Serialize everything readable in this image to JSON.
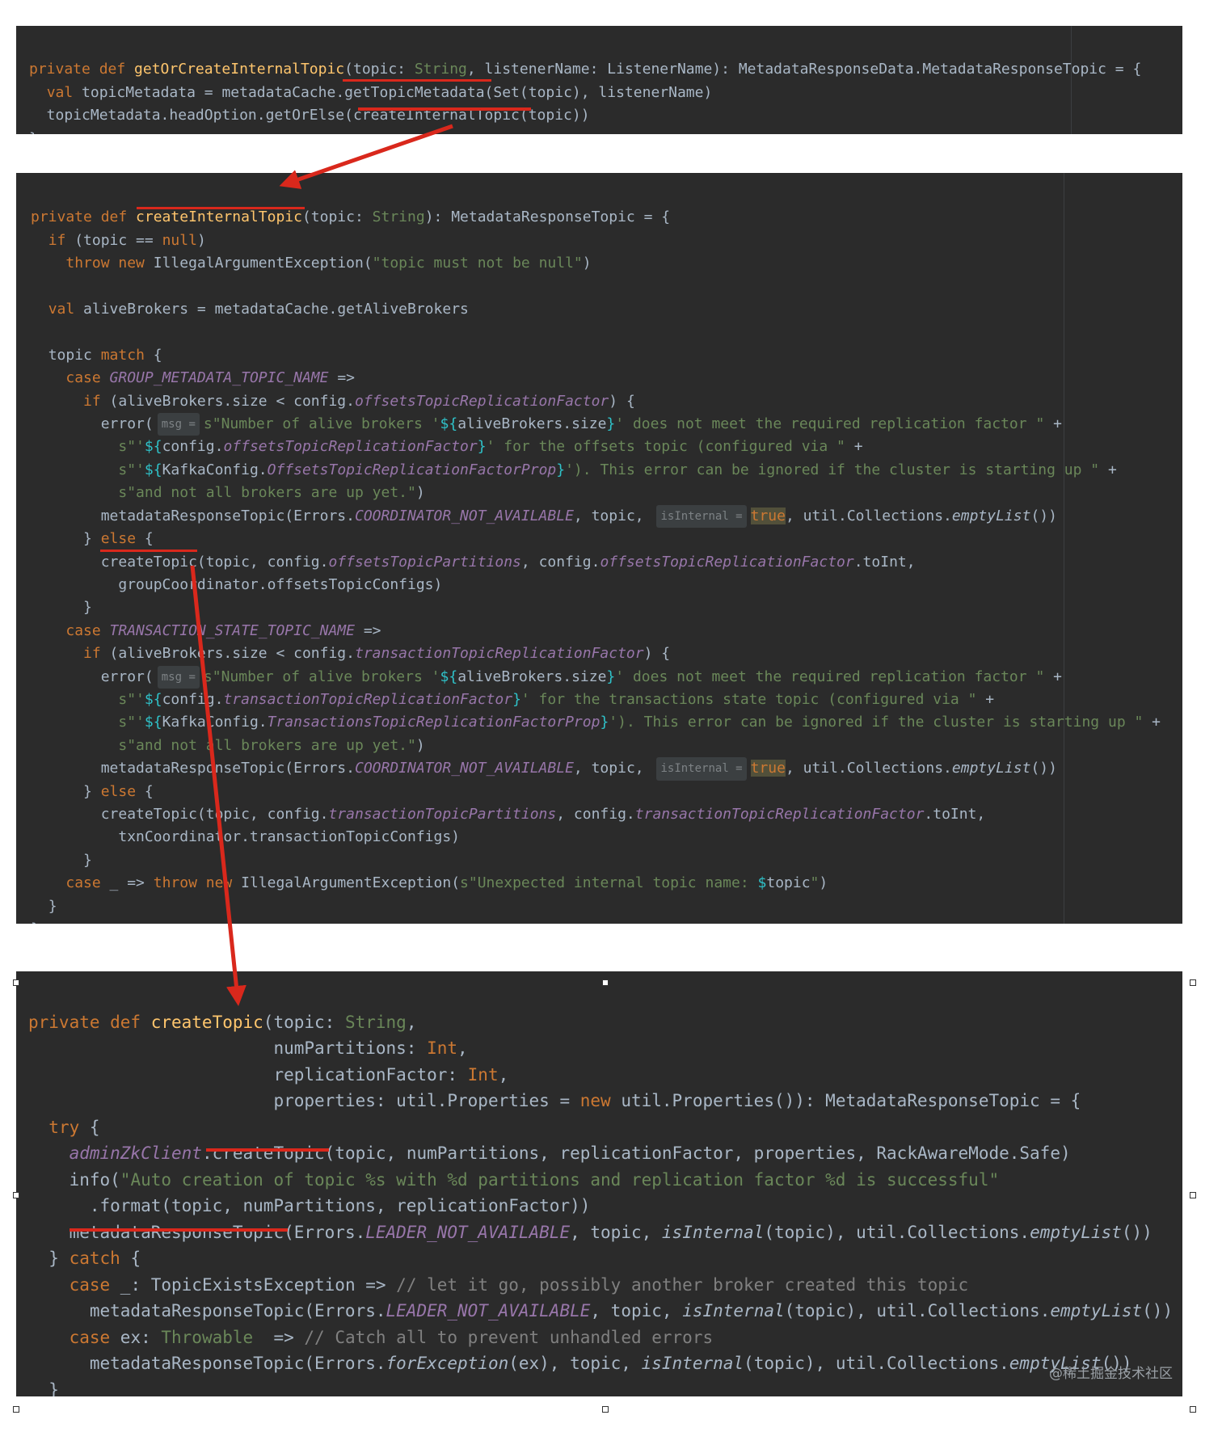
{
  "panel1": {
    "lines": [
      {
        "a": "private def ",
        "b": "getOrCreateInternalTopic",
        "c": "(topic: ",
        "d": "String",
        ",e": "",
        "f": ", listenerName: ListenerName): MetadataResponseData.MetadataResponseTopic = {"
      },
      {
        "a": "val ",
        "b": "topicMetadata = metadataCache.getTopicMetadata(Set(topic), listenerName)"
      },
      {
        "a": "topicMetadata.headOption.getOrElse(createInternalTopic(topic))"
      },
      {
        "a": "}"
      }
    ]
  },
  "panel2": {
    "header": {
      "kw": "private def ",
      "fn": "createInternalTopic",
      "rest1": "(topic: ",
      "type": "String",
      "rest2": "): MetadataResponseTopic = {"
    },
    "if_null": {
      "kw": "if ",
      "rest1": "(topic == ",
      "null": "null",
      "rest2": ")"
    },
    "throw_null": {
      "kw": "throw new ",
      "rest1": "IllegalArgumentException(",
      "str": "\"topic must not be null\"",
      "rest2": ")"
    },
    "alive": {
      "kw": "val ",
      "rest": "aliveBrokers = metadataCache.getAliveBrokers"
    },
    "match": {
      "rest": "topic ",
      "kw": "match ",
      "brace": "{"
    },
    "case1": {
      "kw": "case ",
      "const": "GROUP_METADATA_TOPIC_NAME",
      "arrow": " =>"
    },
    "if1": {
      "kw": "if ",
      "rest1": "(aliveBrokers.size < config.",
      "field": "offsetsTopicReplicationFactor",
      "rest2": ") {"
    },
    "err1a": {
      "rest1": "error(",
      "hint": "msg =",
      "str1": "s\"Number of alive brokers '",
      "dl": "${",
      "rest2": "aliveBrokers.size",
      "dr": "}",
      "str2": "' does not meet the required replication factor \"",
      "plus": " +"
    },
    "err1b": {
      "str1": "s\"'",
      "dl": "${",
      "rest1": "config.",
      "field": "offsetsTopicReplicationFactor",
      "dr": "}",
      "str2": "' for the offsets topic (configured via \"",
      "plus": " +"
    },
    "err1c": {
      "str1": "s\"'",
      "dl": "${",
      "rest1": "KafkaConfig.",
      "field": "OffsetsTopicReplicationFactorProp",
      "dr": "}",
      "str2": "'). This error can be ignored if the cluster is starting up \"",
      "plus": " +"
    },
    "err1d": {
      "str": "s\"and not all brokers are up yet.\"",
      "rest": ")"
    },
    "mrt1": {
      "rest1": "metadataResponseTopic(Errors.",
      "const": "COORDINATOR_NOT_AVAILABLE",
      "rest2": ", topic, ",
      "hint": "isInternal =",
      "val": "true",
      "rest3": ", util.Collections.",
      "fn": "emptyList",
      "rest4": "())"
    },
    "else1": {
      "b1": "} ",
      "kw": "else ",
      "b2": "{"
    },
    "ct1": {
      "rest1": "createTopic(topic, config.",
      "f1": "offsetsTopicPartitions",
      "rest2": ", config.",
      "f2": "offsetsTopicReplicationFactor",
      "rest3": ".toInt,"
    },
    "ct1b": {
      "rest": "groupCoordinator.offsetsTopicConfigs)"
    },
    "close1": {
      "rest": "}"
    },
    "case2": {
      "kw": "case ",
      "const": "TRANSACTION_STATE_TOPIC_NAME",
      "arrow": " =>"
    },
    "if2": {
      "kw": "if ",
      "rest1": "(aliveBrokers.size < config.",
      "field": "transactionTopicReplicationFactor",
      "rest2": ") {"
    },
    "err2a": {
      "rest1": "error(",
      "hint": "msg =",
      "str1": "s\"Number of alive brokers '",
      "dl": "${",
      "rest2": "aliveBrokers.size",
      "dr": "}",
      "str2": "' does not meet the required replication factor \"",
      "plus": " +"
    },
    "err2b": {
      "str1": "s\"'",
      "dl": "${",
      "rest1": "config.",
      "field": "transactionTopicReplicationFactor",
      "dr": "}",
      "str2": "' for the transactions state topic (configured via \"",
      "plus": " +"
    },
    "err2c": {
      "str1": "s\"'",
      "dl": "${",
      "rest1": "KafkaConfig.",
      "field": "TransactionsTopicReplicationFactorProp",
      "dr": "}",
      "str2": "'). This error can be ignored if the cluster is starting up \"",
      "plus": " +"
    },
    "err2d": {
      "str": "s\"and not all brokers are up yet.\"",
      "rest": ")"
    },
    "mrt2": {
      "rest1": "metadataResponseTopic(Errors.",
      "const": "COORDINATOR_NOT_AVAILABLE",
      "rest2": ", topic, ",
      "hint": "isInternal =",
      "val": "true",
      "rest3": ", util.Collections.",
      "fn": "emptyList",
      "rest4": "())"
    },
    "else2": {
      "b1": "} ",
      "kw": "else ",
      "b2": "{"
    },
    "ct2": {
      "rest1": "createTopic(topic, config.",
      "f1": "transactionTopicPartitions",
      "rest2": ", config.",
      "f2": "transactionTopicReplicationFactor",
      "rest3": ".toInt,"
    },
    "ct2b": {
      "rest": "txnCoordinator.transactionTopicConfigs)"
    },
    "close2": {
      "rest": "}"
    },
    "case3": {
      "kw1": "case ",
      "rest1": "_ => ",
      "kw2": "throw new ",
      "rest2": "IllegalArgumentException(",
      "str1": "s\"Unexpected internal topic name: ",
      "dl": "$",
      "rest3": "topic",
      "str2": "\"",
      "rest4": ")"
    },
    "close3": {
      "rest": "}"
    },
    "close4": {
      "rest": "}"
    }
  },
  "panel3": {
    "h1": {
      "kw": "private def ",
      "fn": "createTopic",
      "rest1": "(topic: ",
      "type": "String",
      "rest2": ","
    },
    "h2": {
      "rest1": "numPartitions: ",
      "type": "Int",
      "rest2": ","
    },
    "h3": {
      "rest1": "replicationFactor: ",
      "type": "Int",
      "rest2": ","
    },
    "h4": {
      "rest1": "properties: util.Properties = ",
      "kw": "new ",
      "rest2": "util.Properties()): MetadataResponseTopic = {"
    },
    "try": {
      "kw": "try ",
      "rest": "{"
    },
    "zk": {
      "field": "adminZkClient",
      "rest": ".createTopic(topic, numPartitions, replicationFactor, properties, RackAwareMode.Safe)"
    },
    "info": {
      "rest1": "info(",
      "str": "\"Auto creation of topic %s with %d partitions and replication factor %d is successful\""
    },
    "fmt": {
      "rest": ".format(topic, numPartitions, replicationFactor))"
    },
    "mrt": {
      "rest1": "metadataResponseTopic(Errors.",
      "const": "LEADER_NOT_AVAILABLE",
      "rest2": ", topic, ",
      "fn": "isInternal",
      "rest3": "(topic), util.Collections.",
      "fn2": "emptyList",
      "rest4": "())"
    },
    "catch": {
      "b1": "} ",
      "kw": "catch ",
      "b2": "{"
    },
    "case1": {
      "kw": "case ",
      "rest": "_: TopicExistsException => ",
      "cmt": "// let it go, possibly another broker created this topic"
    },
    "mrt2": {
      "rest1": "metadataResponseTopic(Errors.",
      "const": "LEADER_NOT_AVAILABLE",
      "rest2": ", topic, ",
      "fn": "isInternal",
      "rest3": "(topic), util.Collections.",
      "fn2": "emptyList",
      "rest4": "())"
    },
    "case2": {
      "kw": "case ",
      "rest1": "ex: ",
      "type": "Throwable",
      "rest2": "  => ",
      "cmt": "// Catch all to prevent unhandled errors"
    },
    "mrt3": {
      "rest1": "metadataResponseTopic(Errors.",
      "fn1": "forException",
      "rest2": "(ex), topic, ",
      "fn": "isInternal",
      "rest3": "(topic), util.Collections.",
      "fn2": "emptyList",
      "rest4": "())"
    },
    "close1": {
      "rest": "}"
    },
    "close2": {
      "rest": "}"
    }
  },
  "watermark": "@稀土掘金技术社区",
  "colors": {
    "background": "#2b2b2b",
    "keyword": "#cc7832",
    "string": "#6a8759",
    "field": "#9876aa",
    "function": "#ffc66d",
    "annotation": "#d9281c"
  }
}
